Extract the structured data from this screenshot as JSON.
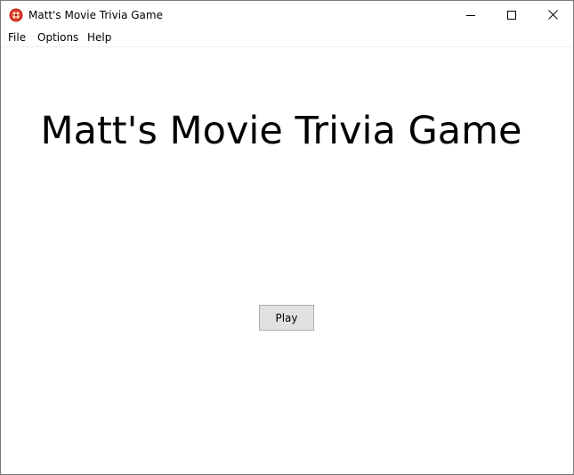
{
  "window": {
    "title": "Matt's Movie Trivia Game",
    "icon": "movie-reel-icon",
    "controls": {
      "minimize": "minimize-icon",
      "maximize": "maximize-icon",
      "close": "close-icon"
    }
  },
  "menubar": {
    "items": [
      {
        "label": "File"
      },
      {
        "label": "Options"
      },
      {
        "label": "Help"
      }
    ]
  },
  "main": {
    "heading": "Matt's Movie Trivia Game",
    "play_label": "Play"
  },
  "colors": {
    "icon_red": "#c8281e",
    "button_face": "#e1e1e1",
    "button_border": "#adadad"
  }
}
